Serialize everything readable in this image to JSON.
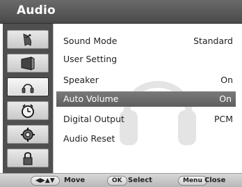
{
  "header": {
    "title": "Audio"
  },
  "sidebar": {
    "items": [
      {
        "icon": "satellite-dish-icon"
      },
      {
        "icon": "picture-icon"
      },
      {
        "icon": "audio-icon",
        "active": true
      },
      {
        "icon": "clock-icon"
      },
      {
        "icon": "settings-gear-icon"
      },
      {
        "icon": "lock-icon"
      }
    ]
  },
  "menu": {
    "items": [
      {
        "label": "Sound Mode",
        "value": "Standard"
      },
      {
        "label": "User Setting",
        "value": ""
      },
      {
        "label": "Speaker",
        "value": "On"
      },
      {
        "label": "Auto Volume",
        "value": "On",
        "selected": true
      },
      {
        "label": "Digital Output",
        "value": "PCM"
      },
      {
        "label": "Audio Reset",
        "value": ""
      }
    ]
  },
  "footer": {
    "move_key": "◀▶▲▼",
    "move_label": "Move",
    "select_key": "OK",
    "select_label": "Select",
    "close_key": "Menu",
    "close_label": "Close"
  },
  "colors": {
    "header_bg": "#4a4a4a",
    "sidebar_bg": "#4f4f4f",
    "selected_row_bg": "#6a6a6a",
    "panel_bg": "#ffffff"
  }
}
